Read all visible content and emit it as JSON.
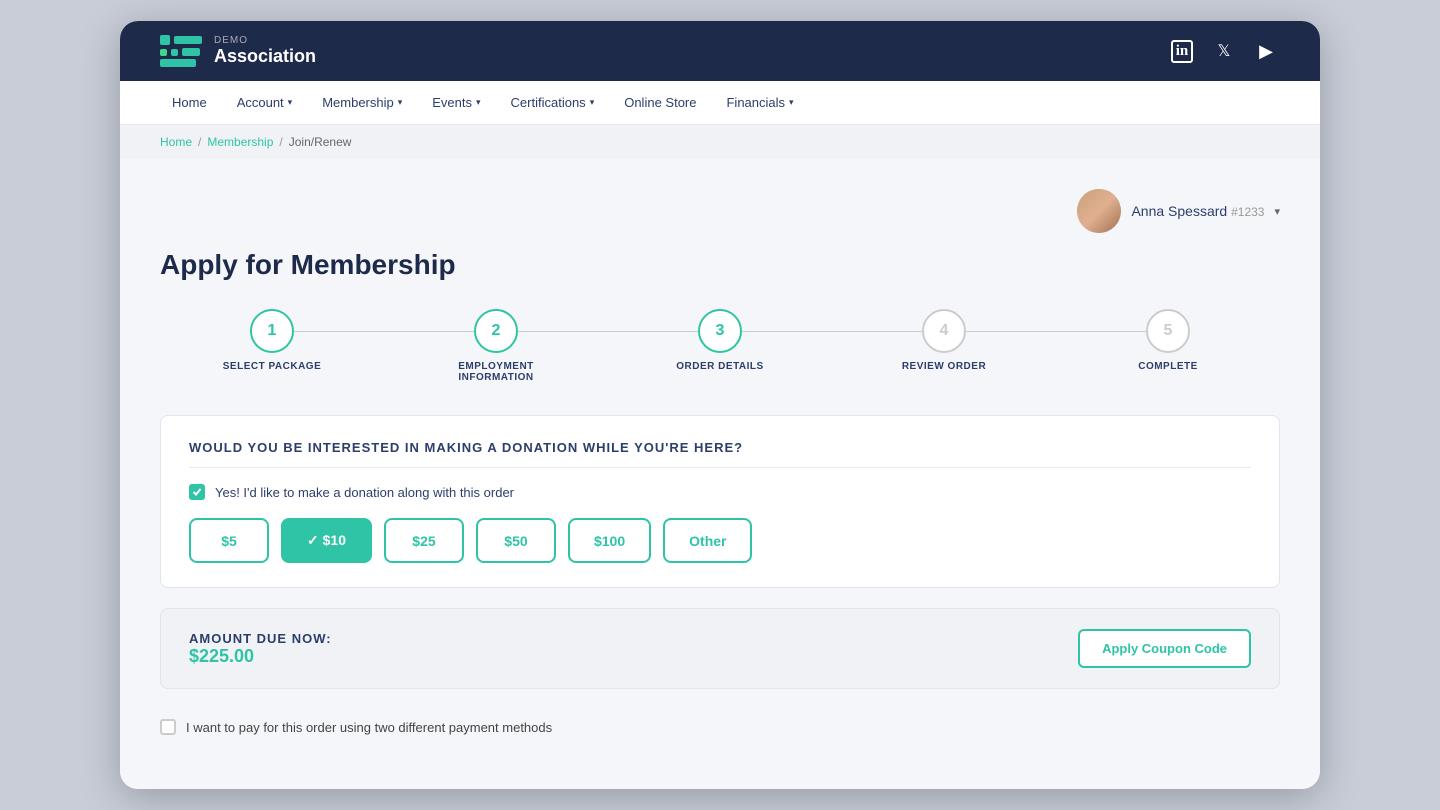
{
  "header": {
    "logo_demo": "DEMO",
    "logo_name": "Association",
    "social": [
      "linkedin",
      "twitter",
      "youtube"
    ]
  },
  "nav": {
    "items": [
      {
        "label": "Home",
        "has_arrow": false
      },
      {
        "label": "Account",
        "has_arrow": true
      },
      {
        "label": "Membership",
        "has_arrow": true
      },
      {
        "label": "Events",
        "has_arrow": true
      },
      {
        "label": "Certifications",
        "has_arrow": true
      },
      {
        "label": "Online Store",
        "has_arrow": false
      },
      {
        "label": "Financials",
        "has_arrow": true
      }
    ]
  },
  "breadcrumb": {
    "items": [
      "Home",
      "Membership",
      "Join/Renew"
    ],
    "links": [
      0,
      1
    ]
  },
  "user": {
    "name": "Anna Spessard",
    "id": "#1233"
  },
  "page": {
    "title": "Apply for Membership"
  },
  "steps": [
    {
      "number": "1",
      "label": "SELECT PACKAGE",
      "state": "active"
    },
    {
      "number": "2",
      "label": "EMPLOYMENT INFORMATION",
      "state": "active"
    },
    {
      "number": "3",
      "label": "ORDER DETAILS",
      "state": "active"
    },
    {
      "number": "4",
      "label": "REVIEW ORDER",
      "state": "inactive"
    },
    {
      "number": "5",
      "label": "COMPLETE",
      "state": "inactive"
    }
  ],
  "donation": {
    "section_title": "WOULD YOU BE INTERESTED IN MAKING A DONATION WHILE YOU'RE HERE?",
    "checkbox_label": "Yes! I'd like to make a donation along with this order",
    "checked": true,
    "buttons": [
      {
        "label": "$5",
        "selected": false
      },
      {
        "label": "$10",
        "selected": true
      },
      {
        "label": "$25",
        "selected": false
      },
      {
        "label": "$50",
        "selected": false
      },
      {
        "label": "$100",
        "selected": false
      },
      {
        "label": "Other",
        "selected": false
      }
    ]
  },
  "amount": {
    "label": "AMOUNT DUE NOW:",
    "value": "$225.00",
    "coupon_button": "Apply Coupon Code"
  },
  "payment": {
    "label": "I want to pay for this order using two different payment methods"
  },
  "colors": {
    "teal": "#2ec4a5",
    "navy": "#1e2a4a",
    "text_dark": "#2c3e6b"
  }
}
